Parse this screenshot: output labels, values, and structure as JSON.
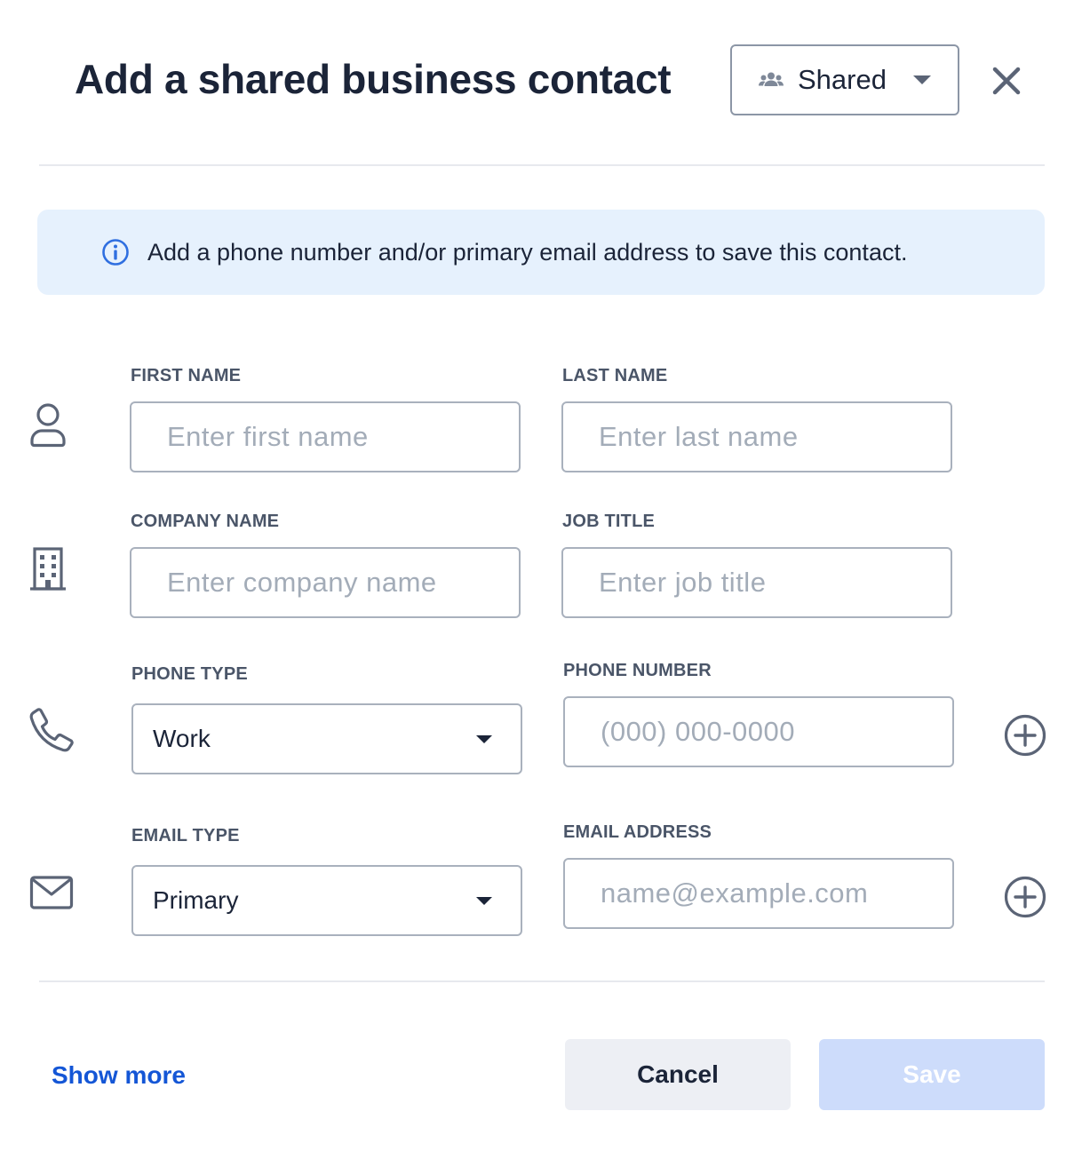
{
  "header": {
    "title": "Add a shared business contact",
    "visibility_value": "Shared"
  },
  "banner": {
    "text": "Add a phone number and/or primary email address to save this contact."
  },
  "form": {
    "first_name": {
      "label": "FIRST NAME",
      "placeholder": "Enter first name",
      "value": ""
    },
    "last_name": {
      "label": "LAST NAME",
      "placeholder": "Enter last name",
      "value": ""
    },
    "company_name": {
      "label": "COMPANY NAME",
      "placeholder": "Enter company name",
      "value": ""
    },
    "job_title": {
      "label": "JOB TITLE",
      "placeholder": "Enter job title",
      "value": ""
    },
    "phone_type": {
      "label": "PHONE TYPE",
      "value": "Work"
    },
    "phone_number": {
      "label": "PHONE NUMBER",
      "placeholder": "(000) 000-0000",
      "value": ""
    },
    "email_type": {
      "label": "EMAIL TYPE",
      "value": "Primary"
    },
    "email_address": {
      "label": "EMAIL ADDRESS",
      "placeholder": "name@example.com",
      "value": ""
    }
  },
  "footer": {
    "show_more": "Show more",
    "cancel": "Cancel",
    "save": "Save"
  },
  "icons": {
    "visibility": "people-icon",
    "close": "close-icon",
    "info": "info-icon",
    "person": "person-icon",
    "company": "building-icon",
    "phone": "phone-icon",
    "email": "envelope-icon",
    "add": "plus-circle-icon"
  },
  "colors": {
    "title": "#1b2438",
    "banner_bg": "#e6f1fd",
    "info_accent": "#2f6fe0",
    "link": "#1456d6",
    "save_disabled_bg": "#cddcfb",
    "cancel_bg": "#edeff4",
    "icon_gray": "#5b6476"
  }
}
